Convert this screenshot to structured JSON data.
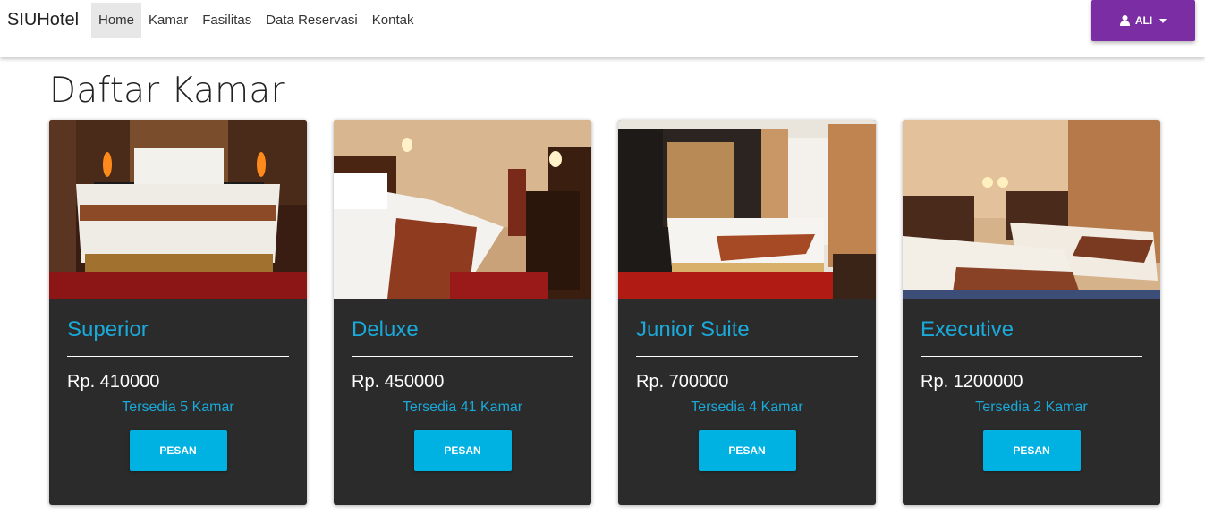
{
  "navbar": {
    "brand": "SIUHotel",
    "links": [
      "Home",
      "Kamar",
      "Fasilitas",
      "Data Reservasi",
      "Kontak"
    ],
    "active_link": "Home",
    "user_label": "ALI",
    "user_color": "#7b2ea3"
  },
  "page": {
    "title": "Daftar Kamar"
  },
  "rooms": [
    {
      "name": "Superior",
      "price": "Rp. 410000",
      "availability": "Tersedia 5 Kamar",
      "button": "PESAN"
    },
    {
      "name": "Deluxe",
      "price": "Rp. 450000",
      "availability": "Tersedia 41 Kamar",
      "button": "PESAN"
    },
    {
      "name": "Junior Suite",
      "price": "Rp. 700000",
      "availability": "Tersedia 4 Kamar",
      "button": "PESAN"
    },
    {
      "name": "Executive",
      "price": "Rp. 1200000",
      "availability": "Tersedia 2 Kamar",
      "button": "PESAN"
    }
  ],
  "colors": {
    "accent": "#1aa9d9",
    "button": "#00b2e2",
    "card_bg": "#2b2b2b"
  },
  "icons": {
    "user": "user-icon",
    "dropdown": "caret-down-icon"
  }
}
